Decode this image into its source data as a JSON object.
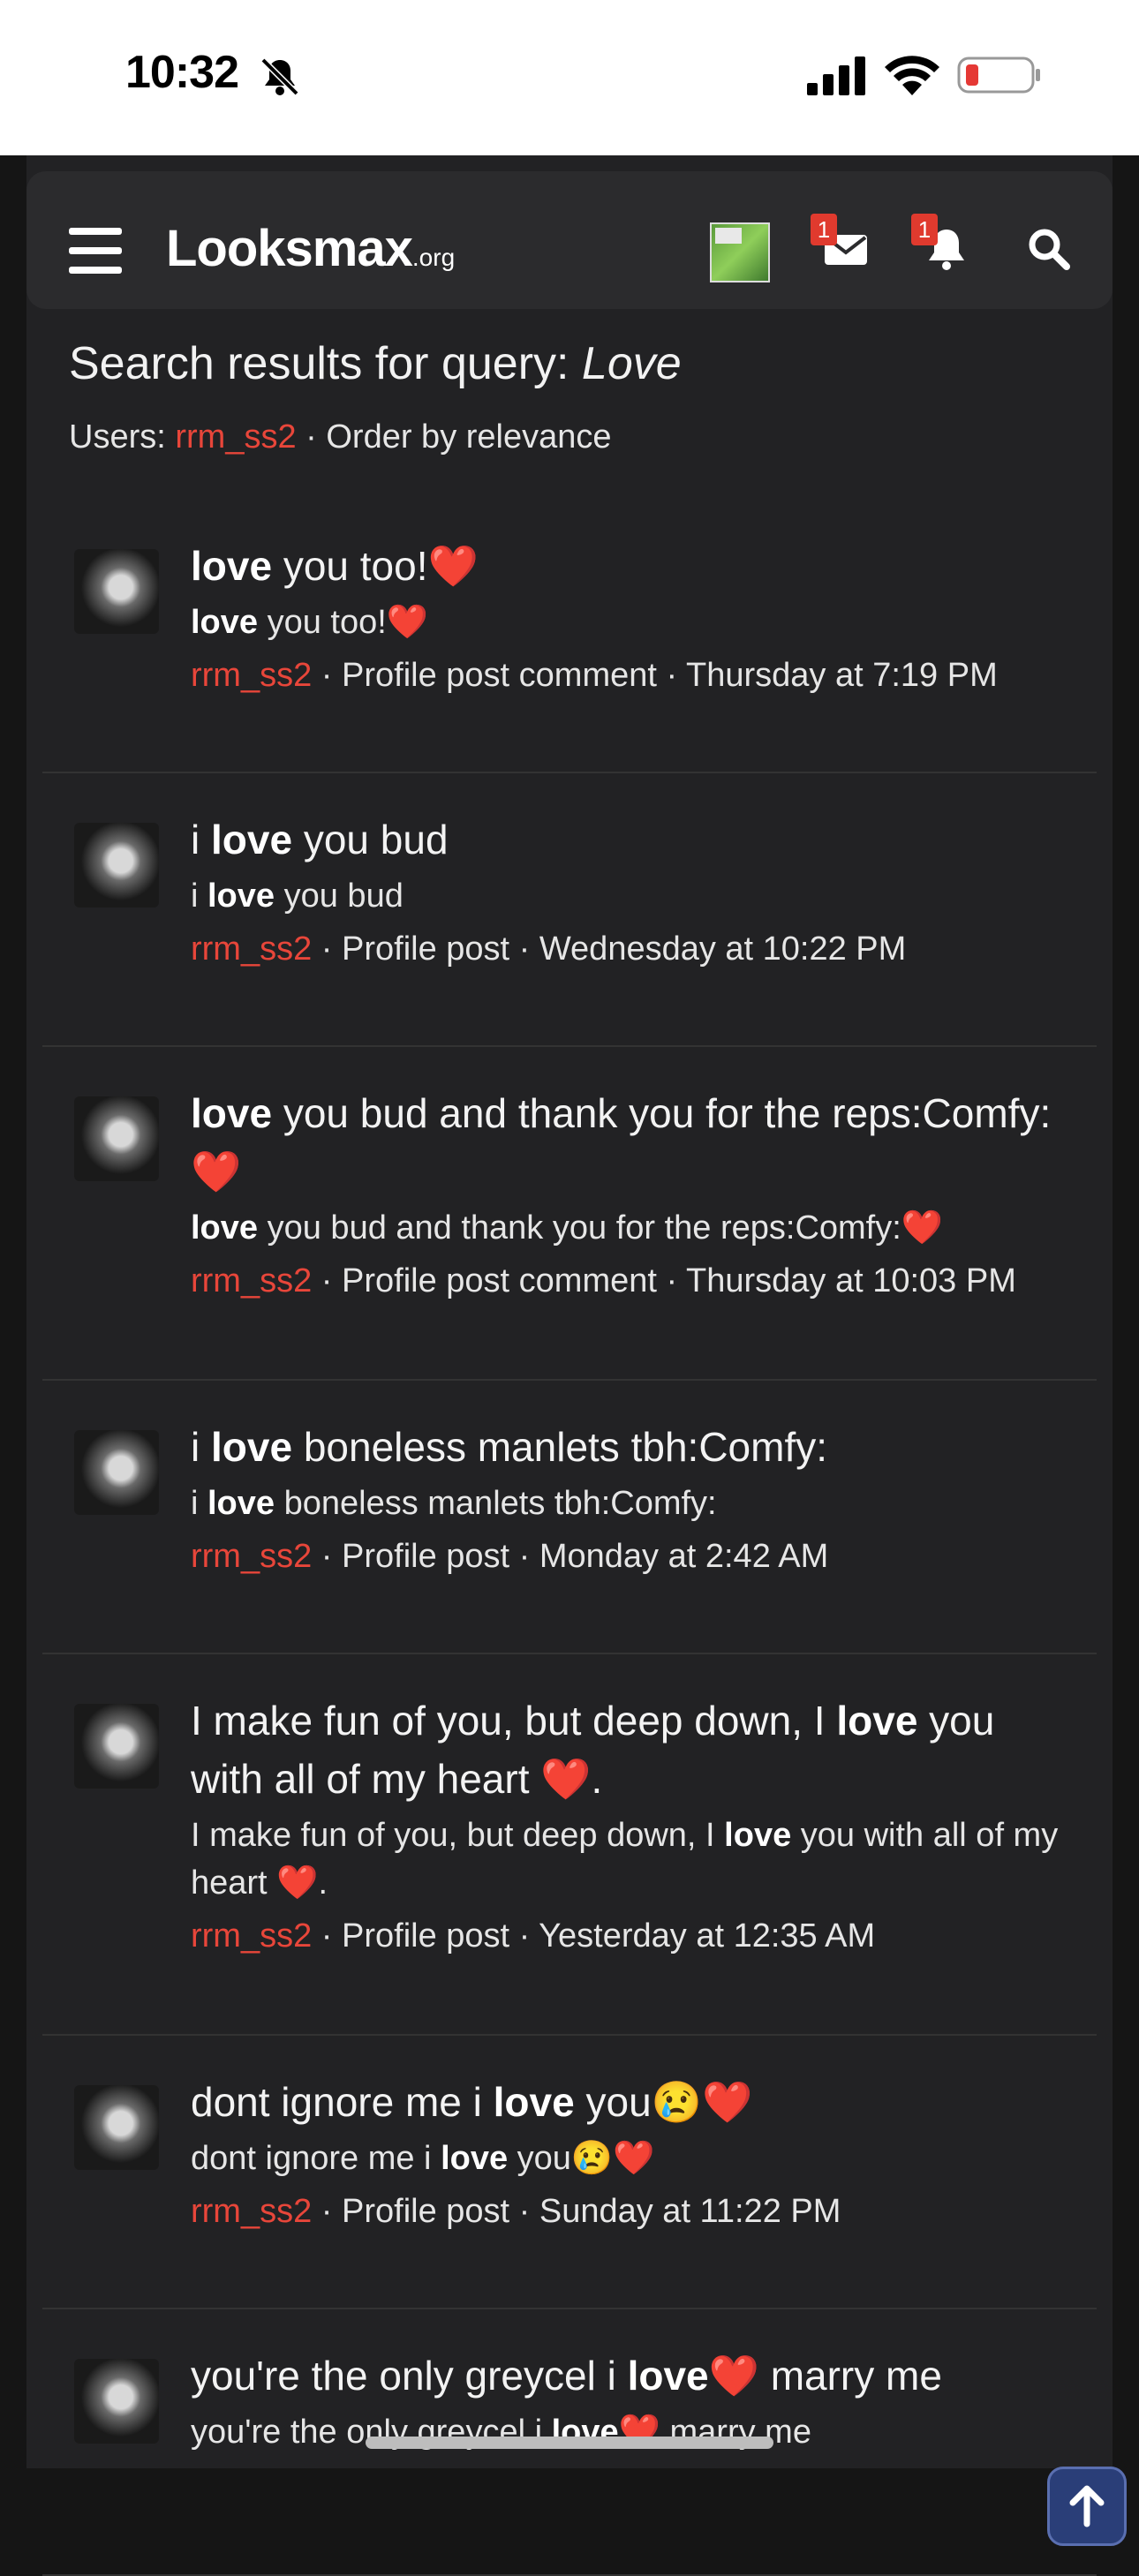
{
  "status_bar": {
    "time": "10:32"
  },
  "navbar": {
    "logo_main": "Looksmax",
    "logo_suffix": ".org",
    "messages_badge": "1",
    "alerts_badge": "1"
  },
  "search": {
    "title_prefix": "Search results for query: ",
    "query": "Love",
    "users_label": "Users: ",
    "user": "rrm_ss2",
    "order": " · Order by relevance"
  },
  "results": [
    {
      "title_parts": [
        "",
        "love",
        " you too!"
      ],
      "title_heart": "❤️",
      "snippet_parts": [
        "",
        "love",
        " you too!"
      ],
      "snippet_heart": "❤️",
      "user": "rrm_ss2",
      "meta": " · Profile post comment · Thursday at 7:19 PM"
    },
    {
      "title_parts": [
        "i ",
        "love",
        " you bud"
      ],
      "title_heart": "",
      "snippet_parts": [
        "i ",
        "love",
        " you bud"
      ],
      "snippet_heart": "",
      "user": "rrm_ss2",
      "meta": " · Profile post · Wednesday at 10:22 PM"
    },
    {
      "title_parts": [
        "",
        "love",
        " you bud and thank you for the reps:Comfy:"
      ],
      "title_heart": "❤️",
      "snippet_parts": [
        "",
        "love",
        " you bud and thank you for the reps:Comfy:"
      ],
      "snippet_heart": "❤️",
      "user": "rrm_ss2",
      "meta": " · Profile post comment · Thursday at 10:03 PM"
    },
    {
      "title_parts": [
        "i ",
        "love",
        " boneless manlets tbh:Comfy:"
      ],
      "title_heart": "",
      "snippet_parts": [
        "i ",
        "love",
        " boneless manlets tbh:Comfy:"
      ],
      "snippet_heart": "",
      "user": "rrm_ss2",
      "meta": " · Profile post · Monday at 2:42 AM"
    },
    {
      "title_parts": [
        "I make fun of you, but deep down, I ",
        "love",
        " you with all of my heart "
      ],
      "title_heart": "❤️",
      "title_after": ".",
      "snippet_parts": [
        "I make fun of you, but deep down, I ",
        "love",
        " you with all of my heart "
      ],
      "snippet_heart": "❤️",
      "snippet_after": ".",
      "user": "rrm_ss2",
      "meta": " · Profile post · Yesterday at 12:35 AM"
    },
    {
      "title_parts": [
        "dont ignore me i ",
        "love",
        " you😢"
      ],
      "title_heart": "❤️",
      "snippet_parts": [
        "dont ignore me i ",
        "love",
        " you😢"
      ],
      "snippet_heart": "❤️",
      "user": "rrm_ss2",
      "meta": " · Profile post · Sunday at 11:22 PM"
    },
    {
      "title_parts": [
        "you're the only greycel i ",
        "love",
        ""
      ],
      "title_heart": "❤️",
      "title_after": " marry me",
      "snippet_parts": [
        "you're the only greycel i ",
        "love",
        ""
      ],
      "snippet_heart": "❤️",
      "snippet_after": " marry me",
      "user": "rrm_ss2",
      "meta": ""
    }
  ],
  "icons": [
    "menu-icon",
    "messages-icon",
    "alerts-icon",
    "search-icon",
    "arrow-up-icon"
  ],
  "colors": {
    "accent_red": "#e8463a",
    "background": "#222224"
  }
}
